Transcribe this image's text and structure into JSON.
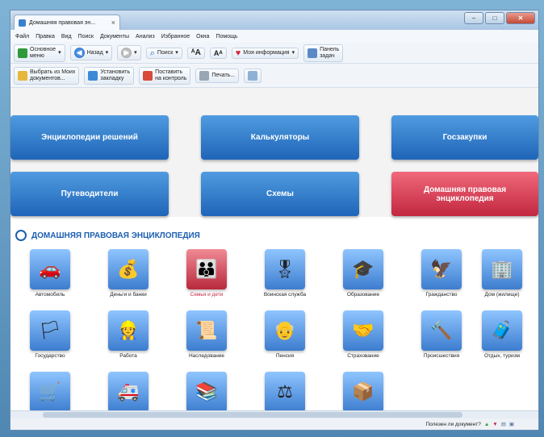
{
  "window": {
    "tab_title": "Домашняя правовая эн...",
    "tab_close": "×",
    "controls": [
      "–",
      "□",
      "✕"
    ]
  },
  "menu": [
    "Файл",
    "Правка",
    "Вид",
    "Поиск",
    "Документы",
    "Анализ",
    "Избранное",
    "Окна",
    "Помощь"
  ],
  "toolbar1": {
    "basic_menu": "Основное\nменю",
    "back": "Назад",
    "search": "Поиск",
    "my_info": "Моя информация",
    "task_panel": "Панель\nзадач"
  },
  "toolbar2": {
    "choose_docs": "Выбрать из Моих\nдокументов...",
    "bookmark": "Установить\nзакладку",
    "control": "Поставить\nна контроль",
    "print": "Печать..."
  },
  "tiles": {
    "encyclopedia": "Энциклопедии решений",
    "calculators": "Калькуляторы",
    "procurement": "Госзакупки",
    "guides": "Путеводители",
    "schemes": "Схемы",
    "home_law": "Домашняя правовая энциклопедия"
  },
  "section_title": "ДОМАШНЯЯ ПРАВОВАЯ ЭНЦИКЛОПЕДИЯ",
  "items": [
    {
      "label": "Автомобиль",
      "icon": "car-icon",
      "glyph": "🚗"
    },
    {
      "label": "Деньги и банки",
      "icon": "safe-icon",
      "glyph": "💰"
    },
    {
      "label": "Семья и дети",
      "icon": "family-icon",
      "glyph": "👪"
    },
    {
      "label": "Воинская служба",
      "icon": "rifle-icon",
      "glyph": "🎖"
    },
    {
      "label": "Образование",
      "icon": "graduation-cap-icon",
      "glyph": "🎓"
    },
    {
      "label": "Гражданство",
      "icon": "coat-of-arms-icon",
      "glyph": "🦅"
    },
    {
      "label": "Дом (жилище)",
      "icon": "building-icon",
      "glyph": "🏢"
    },
    {
      "label": "Государство",
      "icon": "flag-icon",
      "glyph": "🏳"
    },
    {
      "label": "Работа",
      "icon": "worker-icon",
      "glyph": "👷"
    },
    {
      "label": "Наследование",
      "icon": "inheritance-icon",
      "glyph": "📜"
    },
    {
      "label": "Пенсия",
      "icon": "pensioner-icon",
      "glyph": "👴"
    },
    {
      "label": "Страхование",
      "icon": "handshake-icon",
      "glyph": "🤝"
    },
    {
      "label": "Происшествия",
      "icon": "gavel-icon",
      "glyph": "🔨"
    },
    {
      "label": "Отдых, туризм",
      "icon": "suitcase-icon",
      "glyph": "🧳"
    },
    {
      "label": "",
      "icon": "wheelbarrow-icon",
      "glyph": "🛒"
    },
    {
      "label": "",
      "icon": "ambulance-icon",
      "glyph": "🚑"
    },
    {
      "label": "",
      "icon": "documents-icon",
      "glyph": "📚"
    },
    {
      "label": "",
      "icon": "justice-icon",
      "glyph": "⚖"
    },
    {
      "label": "",
      "icon": "box-icon",
      "glyph": "📦"
    }
  ],
  "status": {
    "question": "Полезен ли документ?"
  }
}
